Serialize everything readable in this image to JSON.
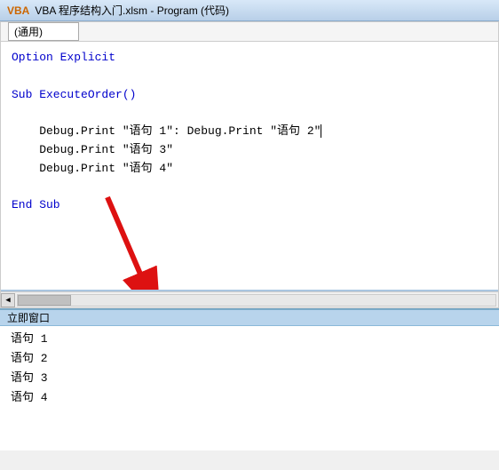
{
  "titlebar": {
    "icon": "VBA",
    "title": "VBA 程序结构入门.xlsm - Program (代码)"
  },
  "dropdown": {
    "label": "(通用)"
  },
  "code": {
    "lines": [
      {
        "text": "Option Explicit",
        "style": "blue",
        "indent": 0
      },
      {
        "text": "",
        "style": "",
        "indent": 0
      },
      {
        "text": "Sub ExecuteOrder()",
        "style": "blue",
        "indent": 0
      },
      {
        "text": "",
        "style": "",
        "indent": 0
      },
      {
        "text": "    Debug.Print \"语句 1\": Debug.Print \"语句 2\"|",
        "style": "normal",
        "indent": 1
      },
      {
        "text": "    Debug.Print \"语句 3\"",
        "style": "normal",
        "indent": 1
      },
      {
        "text": "    Debug.Print \"语句 4\"",
        "style": "normal",
        "indent": 1
      },
      {
        "text": "",
        "style": "",
        "indent": 0
      },
      {
        "text": "End Sub",
        "style": "blue",
        "indent": 0
      }
    ]
  },
  "immediate": {
    "header": "立即窗口",
    "lines": [
      "语句 1",
      "语句 2",
      "语句 3",
      "语句 4"
    ]
  }
}
